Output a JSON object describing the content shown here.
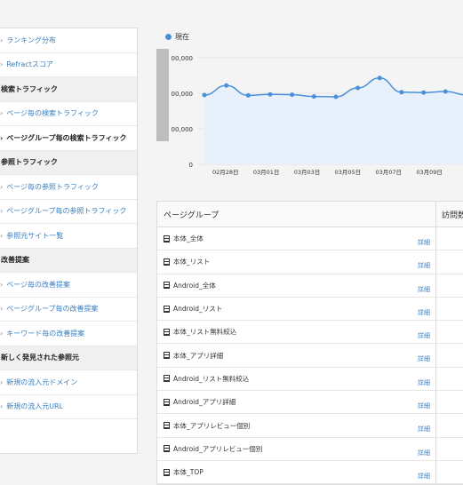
{
  "sidebar": {
    "items": [
      {
        "type": "link",
        "label": "ランキング分布"
      },
      {
        "type": "link",
        "label": "Refractスコア"
      },
      {
        "type": "header",
        "label": "検索トラフィック"
      },
      {
        "type": "link",
        "label": "ページ毎の検索トラフィック"
      },
      {
        "type": "active",
        "label": "ページグループ毎の検索トラフィック"
      },
      {
        "type": "header",
        "label": "参照トラフィック"
      },
      {
        "type": "link",
        "label": "ページ毎の参照トラフィック"
      },
      {
        "type": "link",
        "label": "ページグループ毎の参照トラフィック"
      },
      {
        "type": "link",
        "label": "参照元サイト一覧"
      },
      {
        "type": "header",
        "label": "改善提案"
      },
      {
        "type": "link",
        "label": "ページ毎の改善提案"
      },
      {
        "type": "link",
        "label": "ページグループ毎の改善提案"
      },
      {
        "type": "link",
        "label": "キーワード毎の改善提案"
      },
      {
        "type": "header",
        "label": "新しく発見された参照元"
      },
      {
        "type": "link",
        "label": "新規の流入元ドメイン"
      },
      {
        "type": "link",
        "label": "新規の流入元URL"
      }
    ],
    "chevron": "›"
  },
  "chart_data": {
    "type": "line",
    "legend": [
      "現在"
    ],
    "y_tick_labels": [
      "00,000",
      "00,000",
      "00,000",
      "0"
    ],
    "categories": [
      "02月28日",
      "",
      "03月01日",
      "",
      "03月03日",
      "",
      "03月05日",
      "",
      "03月07日",
      "",
      "03月09日"
    ],
    "x_tick_labels": [
      "02月28日",
      "03月01日",
      "03月03日",
      "03月05日",
      "03月07日",
      "03月09日"
    ],
    "ylim": [
      0,
      3
    ],
    "series": [
      {
        "name": "現在",
        "values": [
          1.95,
          2.22,
          1.94,
          1.97,
          1.96,
          1.91,
          1.9,
          2.15,
          2.43,
          2.03,
          2.02,
          2.05,
          1.95
        ]
      }
    ],
    "color": "#4a90d9",
    "fill": "#e8f1fb"
  },
  "table": {
    "header_group": "ページグループ",
    "header_visits": "訪問数",
    "detail_label": "詳細",
    "rows": [
      "本体_全体",
      "本体_リスト",
      "Android_全体",
      "Android_リスト",
      "本体_リスト無料絞込",
      "本体_アプリ詳細",
      "Android_リスト無料絞込",
      "Android_アプリ詳細",
      "本体_アプリレビュー個別",
      "Android_アプリレビュー個別",
      "本体_TOP"
    ]
  }
}
